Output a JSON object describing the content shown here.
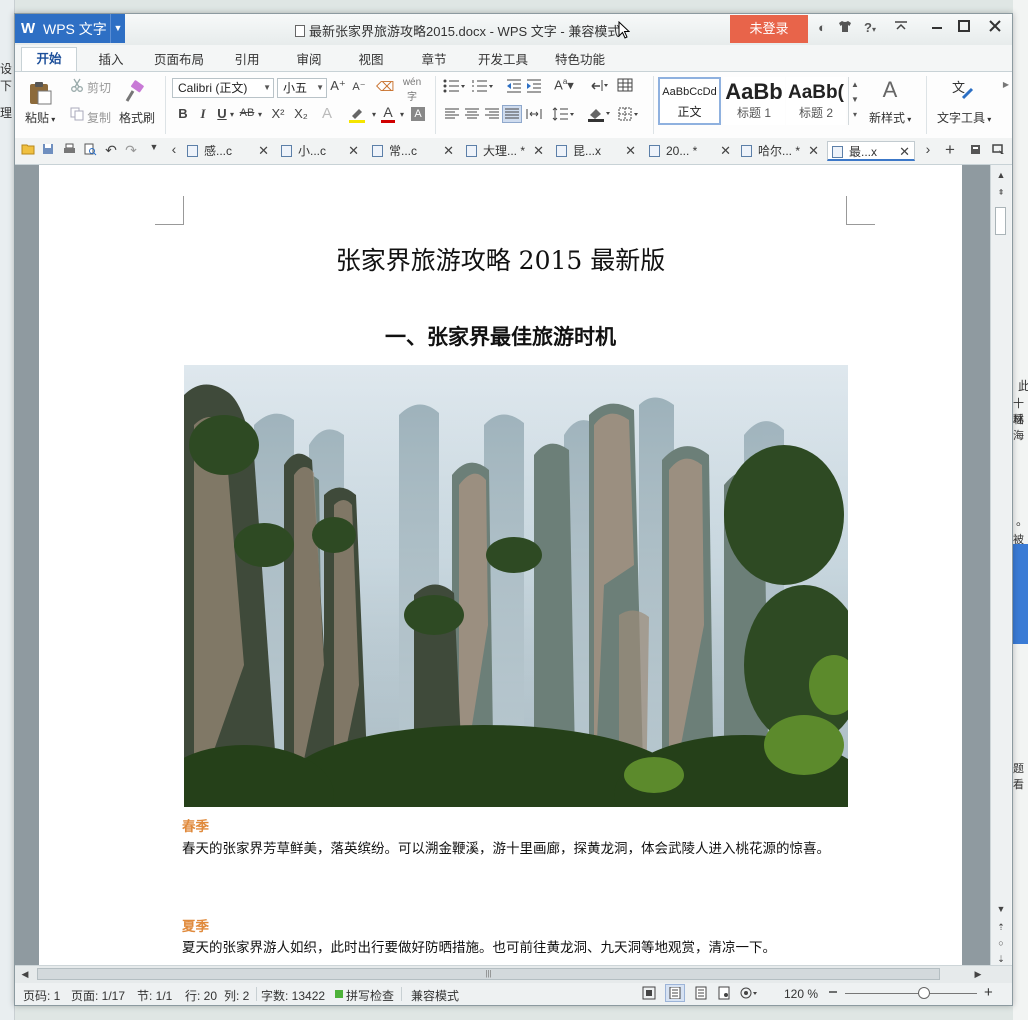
{
  "background": {
    "left_texts": [
      "设下",
      "理"
    ],
    "right_texts": [
      "此",
      "十瑶",
      "林海",
      "。",
      "被卡",
      "题看"
    ]
  },
  "titlebar": {
    "app_button": "WPS 文字",
    "document_title": "最新张家界旅游攻略2015.docx - WPS 文字 - 兼容模式",
    "login_button": "未登录",
    "help_label": "?"
  },
  "ribbon": {
    "tabs": [
      "开始",
      "插入",
      "页面布局",
      "引用",
      "审阅",
      "视图",
      "章节",
      "开发工具",
      "特色功能"
    ],
    "active_tab": "开始",
    "clipboard": {
      "paste_label": "粘贴",
      "cut_label": "剪切",
      "copy_label": "复制",
      "format_painter_label": "格式刷"
    },
    "font": {
      "font_name": "Calibri (正文)",
      "font_size": "小五",
      "grow_label": "A⁺",
      "shrink_label": "A⁻",
      "bold": "B",
      "italic": "I",
      "underline": "U",
      "strikethrough": "AB",
      "superscript": "X²",
      "subscript": "X₂",
      "font_color_letter": "A"
    },
    "styles": [
      {
        "preview": "AaBbCcDd",
        "label": "正文"
      },
      {
        "preview": "AaBb",
        "label": "标题 1"
      },
      {
        "preview": "AaBb(",
        "label": "标题 2"
      }
    ],
    "new_style_label": "新样式",
    "text_tools_label": "文字工具"
  },
  "doc_tabs": [
    {
      "label": "感...c",
      "active": false
    },
    {
      "label": "小...c",
      "active": false
    },
    {
      "label": "常...c",
      "active": false
    },
    {
      "label": "大理... *",
      "active": false
    },
    {
      "label": "昆...x",
      "active": false
    },
    {
      "label": "20... *",
      "active": false
    },
    {
      "label": "哈尔... *",
      "active": false
    },
    {
      "label": "最...x",
      "active": true
    }
  ],
  "document": {
    "title": "张家界旅游攻略 2015 最新版",
    "section_heading": "一、张家界最佳旅游时机",
    "photo_alt": "张家界山峰风景图",
    "seasons": [
      {
        "name": "春季",
        "text": "春天的张家界芳草鲜美，落英缤纷。可以溯金鞭溪，游十里画廊，探黄龙洞，体会武陵人进入桃花源的惊喜。"
      },
      {
        "name": "夏季",
        "text": "夏天的张家界游人如织，此时出行要做好防晒措施。也可前往黄龙洞、九天洞等地观赏，清凉一下。"
      }
    ]
  },
  "statusbar": {
    "page_code": "页码: 1",
    "page": "页面: 1/17",
    "section": "节: 1/1",
    "row": "行: 20",
    "col": "列: 2",
    "word_count": "字数: 13422",
    "spell_check": "拼写检查",
    "compat_mode": "兼容模式",
    "zoom": "120 %",
    "zoom_level": 0.6
  },
  "colors": {
    "accent_blue": "#2e6fc4",
    "login_red": "#e8644a",
    "season_orange": "#e08a3c"
  }
}
